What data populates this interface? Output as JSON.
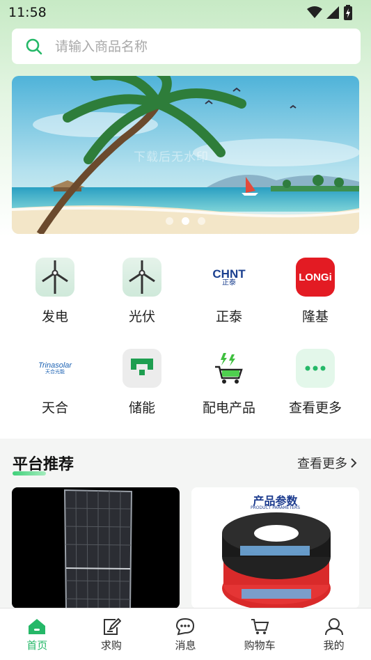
{
  "status_bar": {
    "time": "11:58"
  },
  "search": {
    "placeholder": "请输入商品名称"
  },
  "banner": {
    "watermark": "下载后无水印",
    "dots": 3,
    "active_dot": 1
  },
  "categories": [
    {
      "label": "发电",
      "icon": "wind-turbine-icon"
    },
    {
      "label": "光伏",
      "icon": "wind-turbine-icon"
    },
    {
      "label": "正泰",
      "icon": "chint-logo",
      "logo_text": "CHNT",
      "logo_sub": "正泰"
    },
    {
      "label": "隆基",
      "icon": "longi-logo",
      "logo_text": "LONGi"
    },
    {
      "label": "天合",
      "icon": "trinasolar-logo",
      "logo_text": "Trinasolar",
      "logo_sub": "天合光能"
    },
    {
      "label": "储能",
      "icon": "energy-storage-icon"
    },
    {
      "label": "配电产品",
      "icon": "cart-bolt-icon"
    },
    {
      "label": "查看更多",
      "icon": "more-dots-icon"
    }
  ],
  "section": {
    "title": "平台推荐",
    "more": "查看更多"
  },
  "products": [
    {
      "name": "solar-panel",
      "image_text": ""
    },
    {
      "name": "cable",
      "heading": "产品参数",
      "sub": "PRODUCT PARAMETERS"
    }
  ],
  "tabs": [
    {
      "label": "首页",
      "icon": "home-icon",
      "active": true
    },
    {
      "label": "求购",
      "icon": "edit-note-icon",
      "active": false
    },
    {
      "label": "消息",
      "icon": "chat-icon",
      "active": false
    },
    {
      "label": "购物车",
      "icon": "cart-icon",
      "active": false
    },
    {
      "label": "我的",
      "icon": "user-icon",
      "active": false
    }
  ],
  "colors": {
    "brand_green": "#25b868",
    "longi_red": "#e31b23",
    "chint_blue": "#1a3f8f"
  }
}
